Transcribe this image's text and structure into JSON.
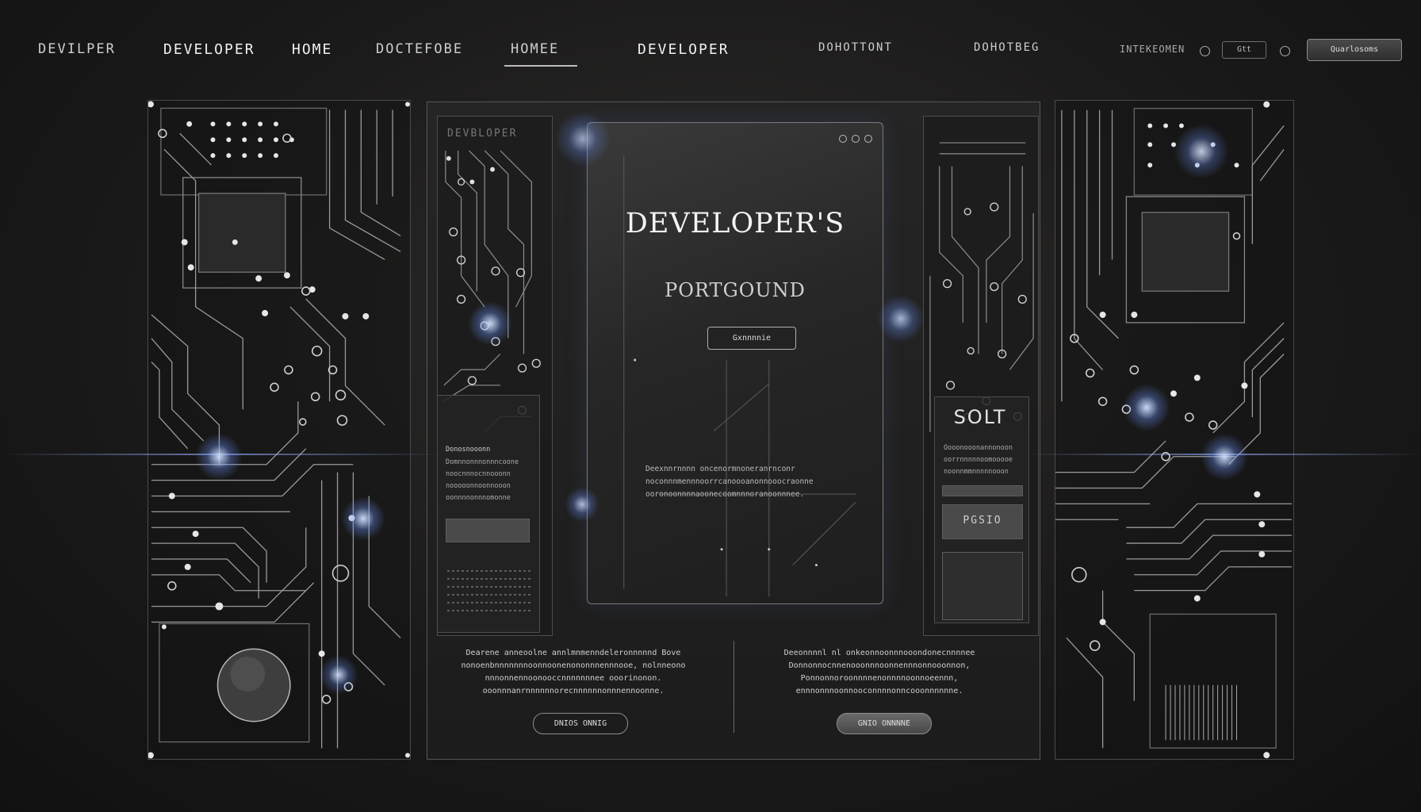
{
  "nav": {
    "brand": "DEVILPER",
    "items": [
      "DEVELOPER",
      "HOME",
      "DOCTEFOBE",
      "HOMEE",
      "DEVELOPER",
      "DOHOTTONT",
      "DOHOTBEG"
    ],
    "right_link": "INTEKEOMEN",
    "right_box": "Gtt",
    "right_button": "Quarlosoms"
  },
  "hero": {
    "title": "DEVELOPER'S",
    "subtitle": "PORTGOUND",
    "button": "Gxnnnnie",
    "description": "Deexnnrnnnn oncenormnoneranrnconr noconnnmennnoorrcanoooanonnooocraonne ooronoonnnnaoonecoomnnnoranoonnnee."
  },
  "left_column": {
    "label": "DEVBLOPER",
    "heading": "Donosnooonn",
    "text": "Domnnonnnonnncoone noocnnnocnnooonn nooooonnoonnooon oonnnnonnnomonne"
  },
  "right_column": {
    "title": "SOLT",
    "text": "Oooonooonannonoon oorrnnnnnoomooooe noonnmmnnnnnooon",
    "bar_label": "PGSIO"
  },
  "bottom": {
    "left_text": "Dearene anneoolne annlmnmenndeleronnnnnd Bove nonoenbnnnnnnnoonnoonenononnnennnooe, nolnneono nnnonnennoonooccnnnnnnnee ooorinonon. ooonnnanrnnnnnnorecnnnnnnonnnennoonne.",
    "left_button": "DNIOS ONNIG",
    "right_text": "Deeonnnnl nl onkeonnoonnnooondonecnnnnee Donnonnocnnenooonnnoonnennnonnooonnon, Ponnonnoroonnnnenonnnnoonnoeennn, ennnonnnoonnooconnnnonncooonnnnnne.",
    "right_button": "GNIO ONNNNE"
  }
}
